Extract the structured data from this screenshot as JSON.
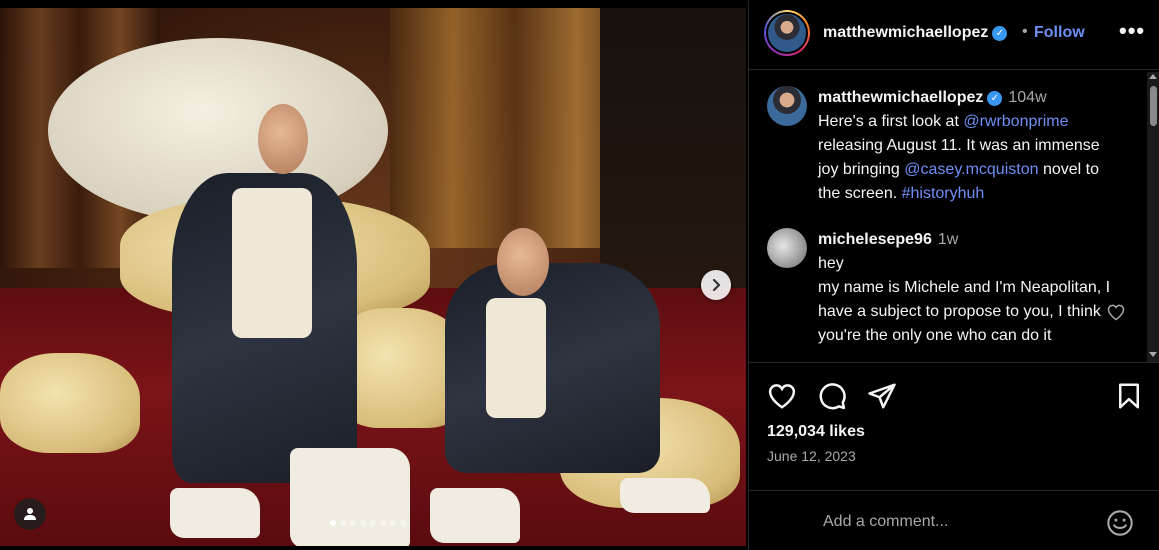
{
  "post": {
    "username": "matthewmichaellopez",
    "separator": "•",
    "follow_label": "Follow",
    "more_label": "•••"
  },
  "caption": {
    "username": "matthewmichaellopez",
    "time": "104w",
    "text_1": "Here's a first look at ",
    "mention_1": "@rwrbonprime",
    "text_2": " releasing August 11. It was an immense joy bringing ",
    "mention_2": "@casey.mcquiston",
    "text_3": " novel to the screen. ",
    "hashtag": "#historyhuh"
  },
  "comment_1": {
    "username": "michelesepe96",
    "time": "1w",
    "line_1": "hey",
    "line_2": "my name is Michele and I'm Neapolitan, I have a subject to propose to you, I think you're the only one who can do it"
  },
  "stats": {
    "likes": "129,034 likes",
    "date": "June 12, 2023"
  },
  "composer": {
    "placeholder": "Add a comment..."
  },
  "icons": {
    "like": "heart-icon",
    "comment": "comment-bubble-icon",
    "share": "paper-plane-icon",
    "save": "bookmark-icon",
    "emoji": "smiley-icon",
    "next": "chevron-right-icon",
    "tag": "person-icon"
  },
  "colors": {
    "link": "#6f8ff6",
    "verified": "#3897f0",
    "muted": "#a8a8a8"
  },
  "carousel": {
    "slide_count": 8,
    "active_index": 0
  }
}
